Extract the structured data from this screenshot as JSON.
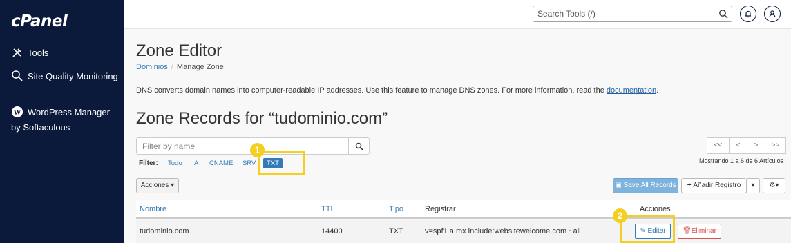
{
  "app": {
    "logo": "cPanel"
  },
  "sidebar": {
    "items": [
      {
        "label": "Tools",
        "icon": "tools-icon"
      },
      {
        "label": "Site Quality Monitoring",
        "icon": "magnifier-icon"
      },
      {
        "label": "WordPress Manager by Softaculous",
        "icon": "wordpress-icon"
      }
    ]
  },
  "header": {
    "search_placeholder": "Search Tools (/)"
  },
  "page": {
    "title": "Zone Editor",
    "breadcrumb": {
      "parent": "Dominios",
      "current": "Manage Zone"
    },
    "description": "DNS converts domain names into computer-readable IP addresses. Use this feature to manage DNS zones. For more information, read the ",
    "description_link": "documentation",
    "description_end": "."
  },
  "zone": {
    "title": "Zone Records for “tudominio.com”",
    "filter_placeholder": "Filter by name",
    "filter_label": "Filter:",
    "filter_options": [
      "Todo",
      "A",
      "CNAME",
      "SRV"
    ],
    "filter_active": "TXT",
    "pagination": {
      "first": "<<",
      "prev": "<",
      "next": ">",
      "last": ">>"
    },
    "showing": "Mostrando 1 a 6 de 6 Artículos",
    "actions_label": "Acciones",
    "save_all": "Save All Records",
    "add_record": "Añadir Registro"
  },
  "table": {
    "headers": {
      "name": "Nombre",
      "ttl": "TTL",
      "type": "Tipo",
      "record": "Registrar",
      "actions": "Acciones"
    },
    "rows": [
      {
        "name": "tudominio.com",
        "ttl": "14400",
        "type": "TXT",
        "record": "v=spf1 a mx include:websitewelcome.com ~all",
        "edit": "Editar",
        "delete": "Eliminar"
      }
    ]
  },
  "annotations": {
    "step1": "1",
    "step2": "2"
  },
  "colors": {
    "sidebar": "#0b1a3b",
    "accent": "#337ab7",
    "highlight": "#f2cf21",
    "danger": "#d9534f"
  }
}
